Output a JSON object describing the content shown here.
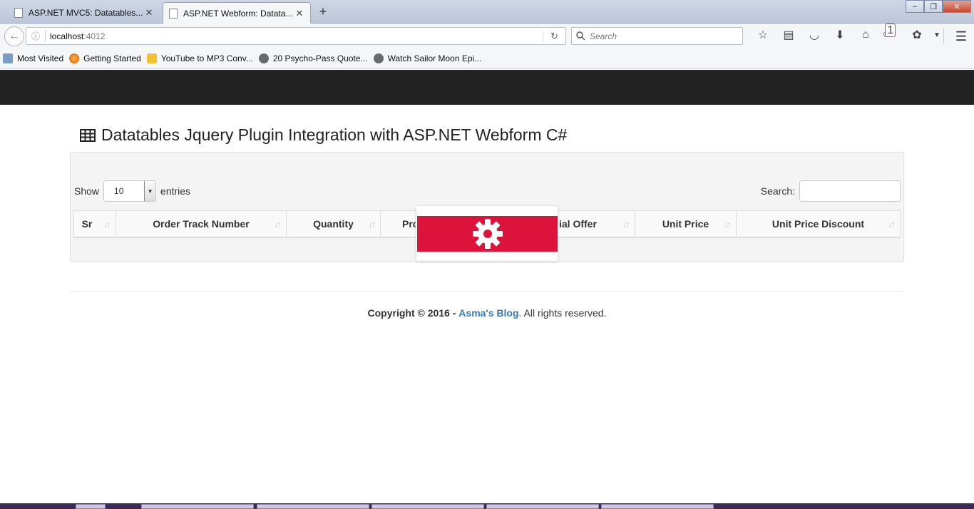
{
  "browser": {
    "tabs": [
      {
        "title": "ASP.NET MVC5: Datatables..."
      },
      {
        "title": "ASP.NET Webform: Datata..."
      }
    ],
    "url_host": "localhost",
    "url_port": ":4012",
    "search_placeholder": "Search",
    "notification_count": "1",
    "bookmarks": [
      {
        "label": "Most Visited",
        "icon": "bookmark-folder-icon"
      },
      {
        "label": "Getting Started",
        "icon": "firefox-icon"
      },
      {
        "label": "YouTube to MP3 Conv...",
        "icon": "crown-icon"
      },
      {
        "label": "20 Psycho-Pass Quote...",
        "icon": "globe-icon"
      },
      {
        "label": "Watch Sailor Moon Epi...",
        "icon": "globe-icon"
      }
    ]
  },
  "page": {
    "heading": "Datatables Jquery Plugin Integration with ASP.NET Webform C#",
    "show_label": "Show",
    "entries_label": "entries",
    "page_length": "10",
    "search_label": "Search:",
    "columns": [
      "Sr",
      "Order Track Number",
      "Quantity",
      "Pro",
      "ial Offer",
      "Unit Price",
      "Unit Price Discount"
    ],
    "footer": {
      "copyright": "Copyright © 2016 -",
      "link": "Asma's Blog",
      "rest": ". All rights reserved."
    },
    "colors": {
      "processing": "#dc143c",
      "navbar": "#222222",
      "link": "#337ab7"
    }
  }
}
